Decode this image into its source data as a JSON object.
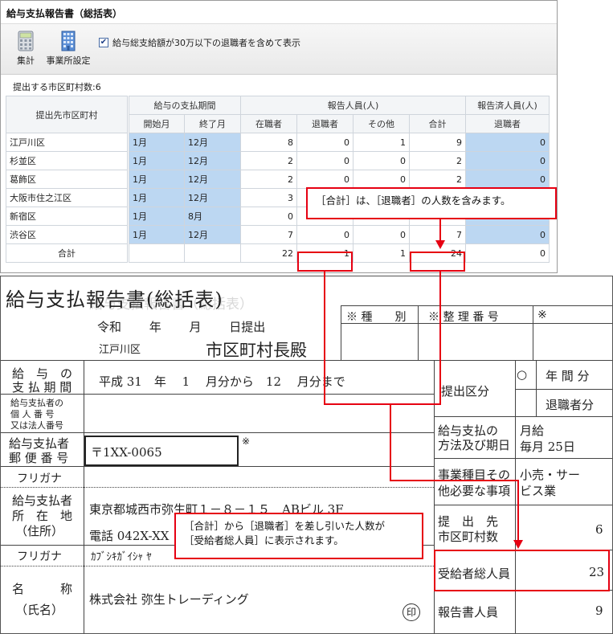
{
  "app": {
    "title": "給与支払報告書（総括表）",
    "toolbar": {
      "calc_label": "集計",
      "office_label": "事業所設定",
      "checkbox_label": "給与総支給額が30万以下の退職者を含めて表示",
      "checkbox_checked": true
    },
    "municipality_count": "提出する市区町村数:6",
    "grid": {
      "headers": {
        "municipality": "提出先市区町村",
        "period_group": "給与の支払期間",
        "start": "開始月",
        "end": "終了月",
        "reported_group": "報告人員(人)",
        "employed": "在職者",
        "retired": "退職者",
        "other": "その他",
        "sum": "合計",
        "reported_done_group": "報告済人員(人)",
        "reported_retired": "退職者"
      },
      "rows": [
        {
          "name": "江戸川区",
          "start": "1月",
          "end": "12月",
          "employed": "8",
          "retired": "0",
          "other": "1",
          "sum": "9",
          "done_retired": "0"
        },
        {
          "name": "杉並区",
          "start": "1月",
          "end": "12月",
          "employed": "2",
          "retired": "0",
          "other": "0",
          "sum": "2",
          "done_retired": "0"
        },
        {
          "name": "葛飾区",
          "start": "1月",
          "end": "12月",
          "employed": "2",
          "retired": "0",
          "other": "0",
          "sum": "2",
          "done_retired": "0"
        },
        {
          "name": "大阪市住之江区",
          "start": "1月",
          "end": "12月",
          "employed": "3",
          "retired": "0",
          "other": "0",
          "sum": "3",
          "done_retired": "0"
        },
        {
          "name": "新宿区",
          "start": "1月",
          "end": "8月",
          "employed": "0",
          "retired": "1",
          "other": "0",
          "sum": "1",
          "done_retired": "0"
        },
        {
          "name": "渋谷区",
          "start": "1月",
          "end": "12月",
          "employed": "7",
          "retired": "0",
          "other": "0",
          "sum": "7",
          "done_retired": "0"
        }
      ],
      "total": {
        "label": "合計",
        "employed": "22",
        "retired": "1",
        "other": "1",
        "sum": "24",
        "done_retired": "0"
      }
    }
  },
  "form": {
    "title": "給与支払報告書(総括表)",
    "title_ghost": "給与支払報告書（総括表）",
    "era_line": "令和　　 年　　 月　　 日提出",
    "city": "江戸川区",
    "addressee": "市区町村長殿",
    "kind_label": "※ 種　　別",
    "ref_label": "※ 整 理 番 号",
    "ref_mark": "※",
    "period_label_1": "給　与　の",
    "period_label_2": "支 払 期 間",
    "period_value": "平成 31　年　 1　 月分から　12　 月分まで",
    "submit_type_label": "提出区分",
    "circle_mark": "○",
    "annual": "年 間 分",
    "retiree_portion": "退職者分",
    "payer_number_label_1": "給与支払者の",
    "payer_number_label_2": "個 人 番 号",
    "payer_number_label_3": "又は法人番号",
    "pay_method_label_1": "給与支払の",
    "pay_method_label_2": "方法及び期日",
    "pay_method_value_1": "月給",
    "pay_method_value_2": "毎月 25日",
    "postal_label_1": "給与支払者",
    "postal_label_2": "郵 便 番 号",
    "postal_value": "〒1XX-0065",
    "postal_mark": "※",
    "furigana_label": "フリガナ",
    "business_label_1": "事業種目その",
    "business_label_2": "他必要な事項",
    "business_value_1": "小売・サー",
    "business_value_2": "ビス業",
    "address_label_1": "給与支払者",
    "address_label_2": "所　在　地",
    "address_label_3": "（住所）",
    "address_value": "東京都城西市弥生町１－８－１５　ABビル 3F",
    "phone_value": "電話 042X-XX",
    "submit_muni_label_1": "提　出　先",
    "submit_muni_label_2": "市区町村数",
    "submit_muni_value": "6",
    "furigana_value": "ｶﾌﾞｼｷｶﾞｲｼｬ ﾔ",
    "recipients_label": "受給者総人員",
    "recipients_value": "23",
    "name_label_1": "名　　　称",
    "name_label_2": "（氏名）",
    "name_value": "株式会社 弥生トレーディング",
    "seal": "印",
    "report_count_label": "報告書人員",
    "report_count_value": "9"
  },
  "callouts": {
    "top": "［合計］は、［退職者］の人数を含みます。",
    "bottom_1": "［合計］から［退職者］を差し引いた人数が",
    "bottom_2": "［受給者総人員］に表示されます。"
  },
  "colors": {
    "accent_red": "#e60012",
    "selected_cell": "#bcd7f2"
  }
}
